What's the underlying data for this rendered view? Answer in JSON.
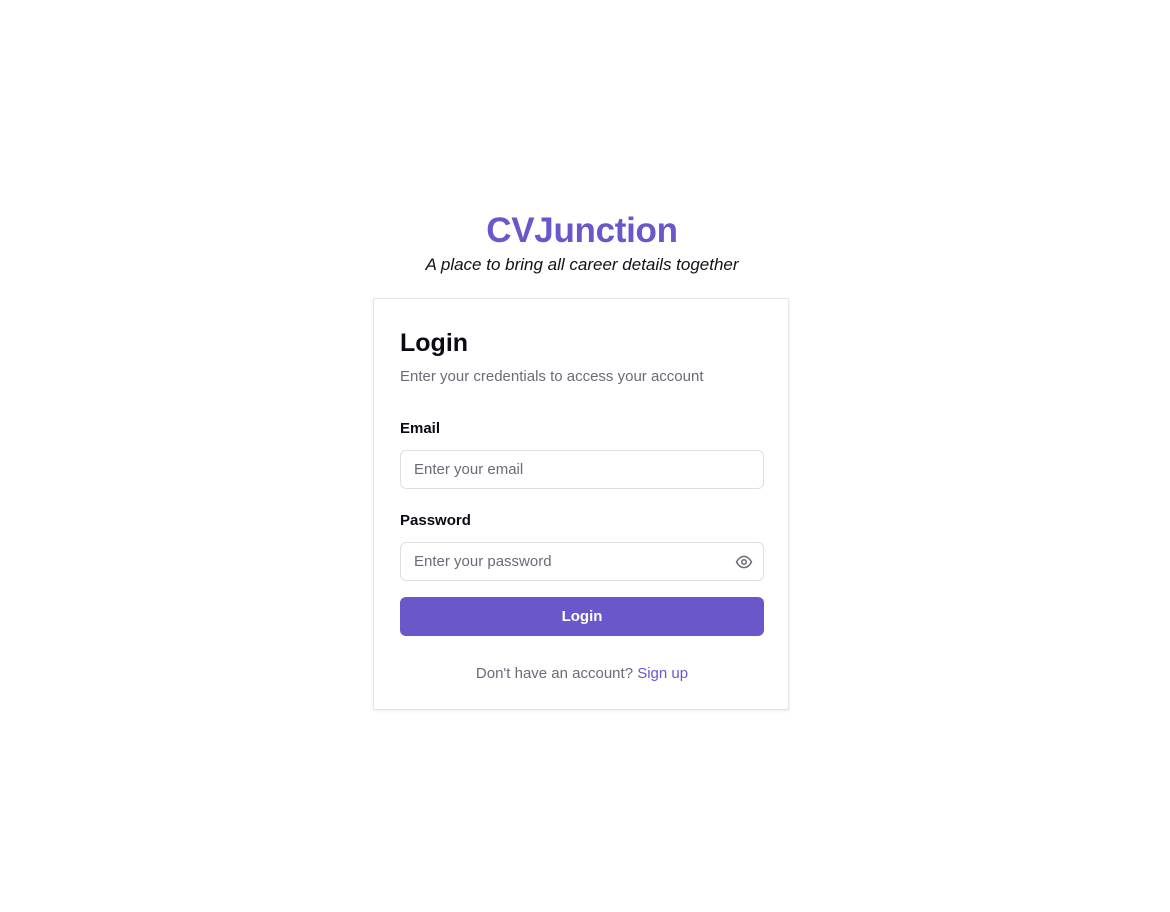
{
  "brand": {
    "title": "CVJunction",
    "tagline": "A place to bring all career details together",
    "accent_color": "#6a57c9"
  },
  "login_card": {
    "title": "Login",
    "subtitle": "Enter your credentials to access your account",
    "email": {
      "label": "Email",
      "placeholder": "Enter your email",
      "value": ""
    },
    "password": {
      "label": "Password",
      "placeholder": "Enter your password",
      "value": "",
      "toggle_icon": "eye-icon"
    },
    "submit_label": "Login",
    "signup_prompt": "Don't have an account?",
    "signup_link": "Sign up"
  }
}
